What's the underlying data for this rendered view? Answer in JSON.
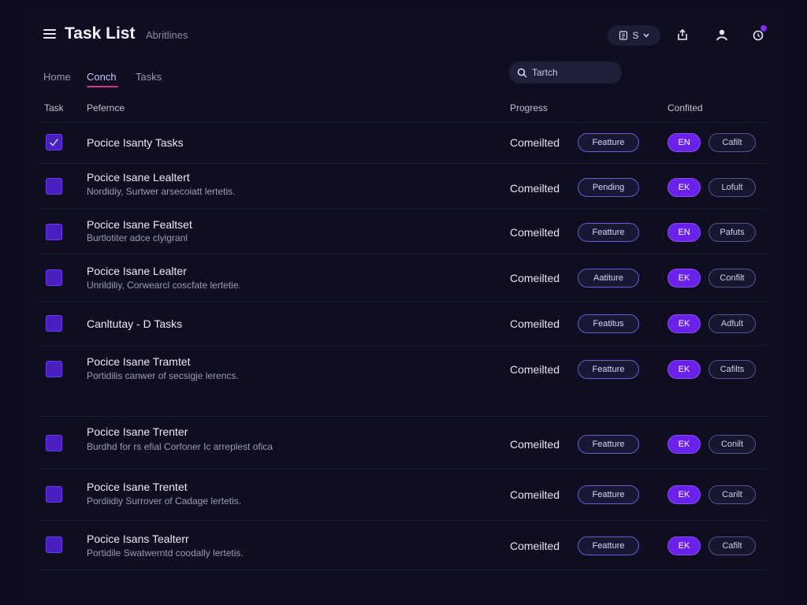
{
  "header": {
    "title": "Task List",
    "subtitle": "Abritlines",
    "account_pill": "S",
    "icons": [
      "menu-icon",
      "document-icon",
      "share-icon",
      "user-icon",
      "notification-icon"
    ]
  },
  "nav": {
    "tabs": [
      {
        "label": "Home",
        "active": false
      },
      {
        "label": "Conch",
        "active": true
      },
      {
        "label": "Tasks",
        "active": false
      }
    ]
  },
  "search": {
    "placeholder": "Tartch"
  },
  "table": {
    "columns": [
      "Task",
      "Pefernce",
      "Progress",
      "Confited"
    ],
    "rows": [
      {
        "title": "Pocice Isanty Tasks",
        "desc": "",
        "checked": true,
        "status": "Comeilted",
        "badge": "Featture",
        "lang": "EN",
        "conflict": "Cafilt"
      },
      {
        "title": "Pocice Isane Lealtert",
        "desc": "Nordidiy, Surtwer arsecoiatt lertetis.",
        "checked": false,
        "status": "Comeilted",
        "badge": "Pending",
        "lang": "EK",
        "conflict": "Lofult"
      },
      {
        "title": "Pocice Isane Fealtset",
        "desc": "Burtlotiter adce clyigranl",
        "checked": false,
        "status": "Comeilted",
        "badge": "Featture",
        "lang": "EN",
        "conflict": "Pafuts"
      },
      {
        "title": "Pocice Isane Lealter",
        "desc": "Unrildiliy, Corwearcl coscfate lertetie.",
        "checked": false,
        "status": "Comeilted",
        "badge": "Aatiture",
        "lang": "EK",
        "conflict": "Confilt"
      },
      {
        "title": "Canltutay - D Tasks",
        "desc": "",
        "checked": false,
        "status": "Comeilted",
        "badge": "Featitus",
        "lang": "EK",
        "conflict": "Adfult"
      },
      {
        "title": "Pocice Isane Tramtet",
        "desc": "Portidilis canwer of secsigje lerencs.",
        "checked": false,
        "status": "Comeilted",
        "badge": "Featture",
        "lang": "EK",
        "conflict": "Cafilts"
      },
      {
        "title": "Pocice Isane Trenter",
        "desc": "Burdhd for rs efial Corfoner Ic arreplest ofica",
        "checked": false,
        "status": "Comeilted",
        "badge": "Featture",
        "lang": "EK",
        "conflict": "Conilt"
      },
      {
        "title": "Pocice Isane Trentet",
        "desc": "Pordiidiy Surrover of Cadage lertetis.",
        "checked": false,
        "status": "Comeilted",
        "badge": "Featture",
        "lang": "EK",
        "conflict": "Carilt"
      },
      {
        "title": "Pocice Isans Tealterr",
        "desc": "Portidile Swatwerntd coodally lertetis.",
        "checked": false,
        "status": "Comeilted",
        "badge": "Featture",
        "lang": "EK",
        "conflict": "Cafilt"
      }
    ]
  },
  "colors": {
    "background": "#0c0c1c",
    "accent": "#6a22ea",
    "checkbox": "#4a1fc0",
    "tab_underline": "#d6338a"
  }
}
